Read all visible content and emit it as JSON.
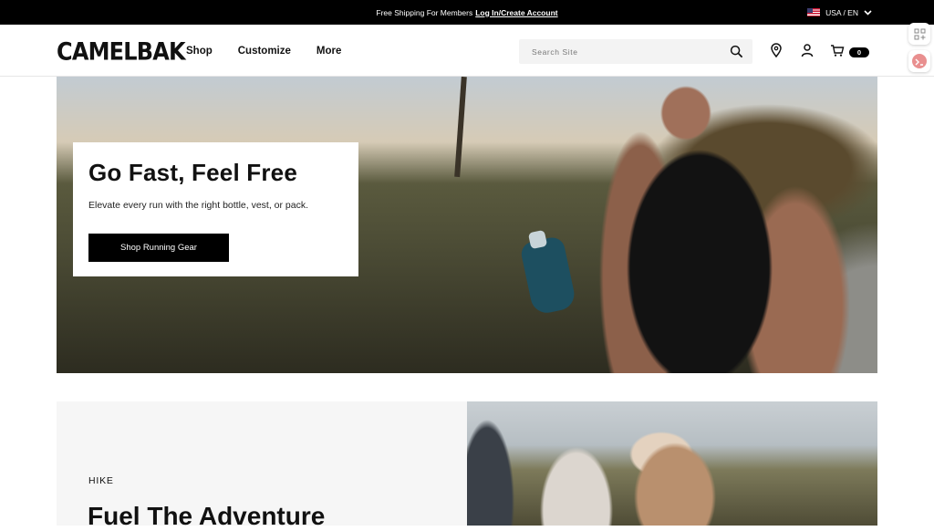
{
  "announcement": {
    "text": "Free Shipping For Members",
    "link": "Log In/Create Account",
    "locale": "USA / EN"
  },
  "header": {
    "logo": "CAMELBAK",
    "nav": [
      "Shop",
      "Customize",
      "More"
    ],
    "search_placeholder": "Search Site",
    "cart_count": "0"
  },
  "hero": {
    "title": "Go Fast, Feel Free",
    "subtitle": "Elevate every run with the right bottle, vest, or pack.",
    "cta": "Shop Running Gear"
  },
  "section2": {
    "eyebrow": "HIKE",
    "title": "Fuel The Adventure"
  },
  "icons": {
    "search": "search-icon",
    "store": "location-pin-icon",
    "account": "user-icon",
    "cart": "cart-icon",
    "locale": "chevron-down-icon"
  },
  "colors": {
    "announce_bg": "#000000",
    "button_bg": "#000000",
    "search_bg": "#f3f3f3"
  }
}
